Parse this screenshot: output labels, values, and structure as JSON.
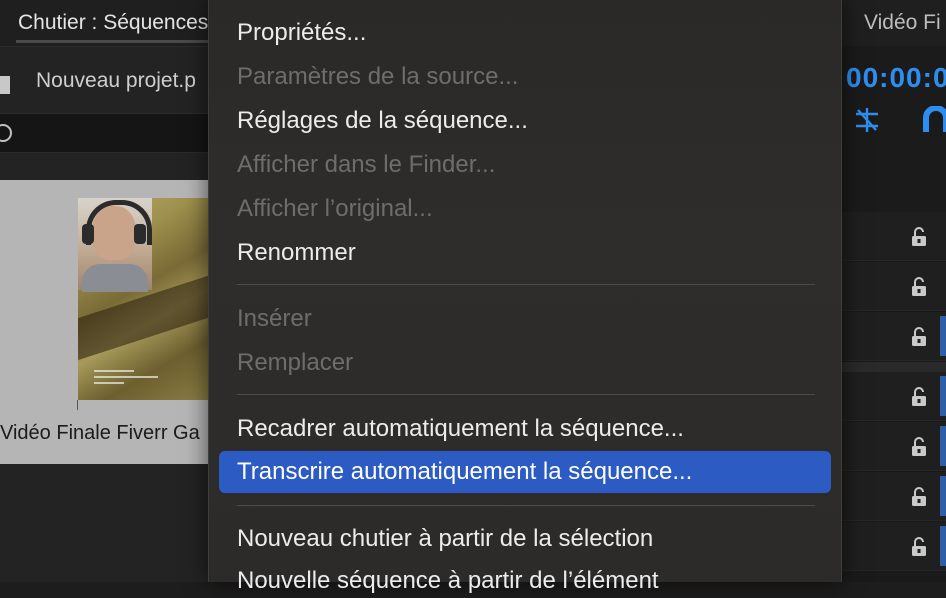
{
  "bin_panel": {
    "tab_title": "Chutier : Séquences",
    "project_path": "Nouveau projet.p",
    "clip_label": "Vidéo Finale Fiverr Ga"
  },
  "program_panel": {
    "tab_title": "Vidéo Fi",
    "timecode": "00:00:0"
  },
  "context_menu": {
    "items": [
      {
        "label": "Propriétés...",
        "enabled": true
      },
      {
        "label": "Paramètres de la source...",
        "enabled": false
      },
      {
        "label": "Réglages de la séquence...",
        "enabled": true
      },
      {
        "label": "Afficher dans le Finder...",
        "enabled": false
      },
      {
        "label": "Afficher l’original...",
        "enabled": false
      },
      {
        "label": "Renommer",
        "enabled": true
      },
      {
        "label": "Insérer",
        "enabled": false
      },
      {
        "label": "Remplacer",
        "enabled": false
      },
      {
        "label": "Recadrer automatiquement la séquence...",
        "enabled": true
      },
      {
        "label": "Transcrire automatiquement la séquence...",
        "enabled": true,
        "highlighted": true
      },
      {
        "label": "Nouveau chutier à partir de la sélection",
        "enabled": true
      },
      {
        "label": "Nouvelle séquence à partir de l’élément",
        "enabled": true
      }
    ]
  },
  "colors": {
    "highlight": "#2c5bc4",
    "timecode": "#2e8ef0",
    "disabled_text": "#6f6d6a",
    "enabled_text": "#ececec"
  }
}
